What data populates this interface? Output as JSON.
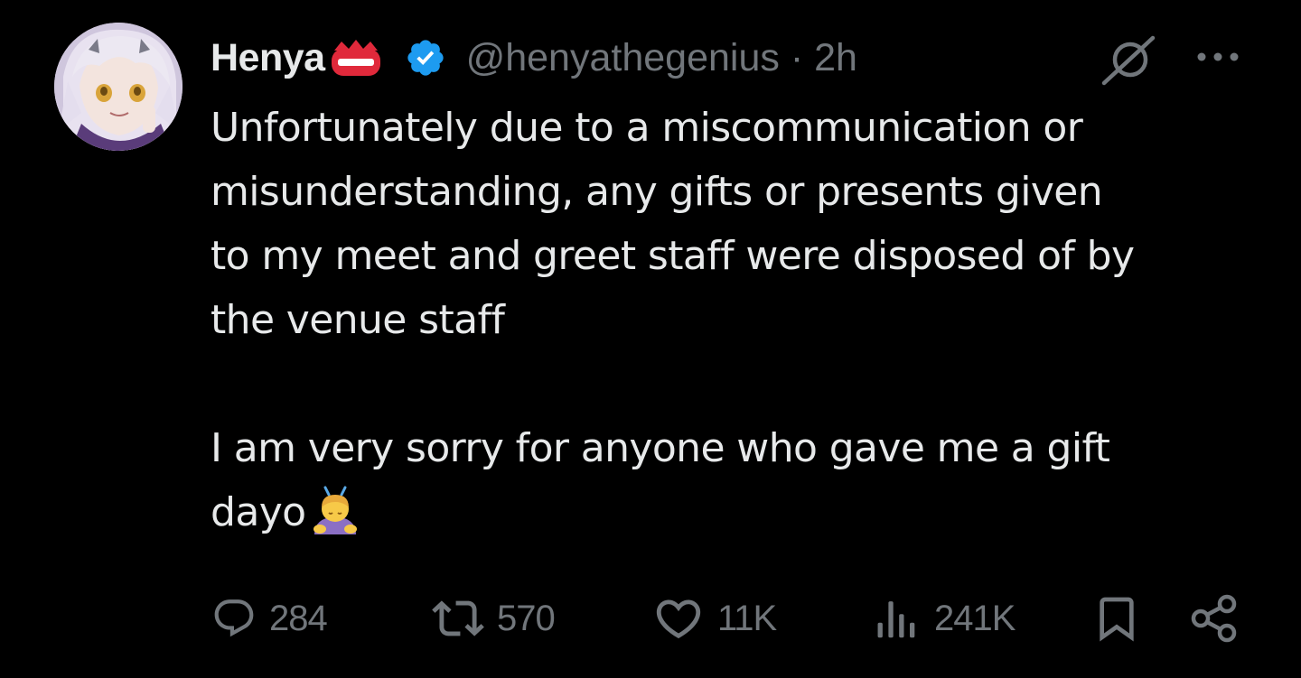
{
  "post": {
    "display_name": "Henya",
    "handle_time": "@henyathegenius · 2h",
    "body_paragraphs": [
      [
        "Unfortunately due to a miscommunication or",
        "misunderstanding, any gifts or presents given",
        "to my meet and greet staff were disposed of by",
        "the venue staff"
      ],
      [
        "I am very sorry for anyone who gave me a gift",
        "dayo"
      ]
    ],
    "emoji": "person-bowing-emoji"
  },
  "actions": {
    "replies": "284",
    "reposts": "570",
    "likes": "11K",
    "views": "241K"
  },
  "icons": {
    "verified": "verified-badge-icon",
    "affiliate": "crown-badge-icon",
    "grok": "grok-icon",
    "more": "more-icon",
    "reply": "reply-icon",
    "repost": "repost-icon",
    "like": "heart-icon",
    "views": "views-icon",
    "bookmark": "bookmark-icon",
    "share": "share-icon"
  },
  "colors": {
    "background": "#000000",
    "text": "#e7e9ea",
    "muted": "#71767b",
    "verified": "#1d9bf0",
    "badge_red": "#e0293b"
  }
}
